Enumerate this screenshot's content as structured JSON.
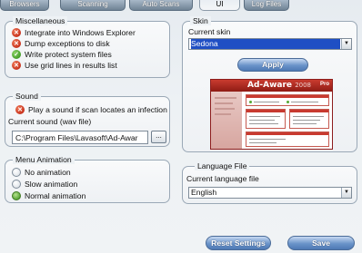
{
  "tabs": [
    {
      "label": "Browsers"
    },
    {
      "label": "Scanning"
    },
    {
      "label": "Auto Scans"
    },
    {
      "label": "UI"
    },
    {
      "label": "Log Files"
    }
  ],
  "miscellaneous": {
    "title": "Miscellaneous",
    "items": [
      {
        "label": "Integrate into Windows Explorer",
        "state": "off"
      },
      {
        "label": "Dump exceptions to disk",
        "state": "off"
      },
      {
        "label": "Write protect system files",
        "state": "on"
      },
      {
        "label": "Use grid lines in results list",
        "state": "off"
      }
    ]
  },
  "sound": {
    "title": "Sound",
    "play_label": "Play a sound if scan locates an infection",
    "current_label": "Current sound (wav file)",
    "file_value": "C:\\Program Files\\Lavasoft\\Ad-Awar",
    "browse_label": "..."
  },
  "menu_animation": {
    "title": "Menu Animation",
    "options": [
      {
        "label": "No animation"
      },
      {
        "label": "Slow animation"
      },
      {
        "label": "Normal animation"
      }
    ],
    "selected": "Normal animation"
  },
  "skin": {
    "title": "Skin",
    "current_label": "Current skin",
    "selected": "Sedona",
    "apply_label": "Apply",
    "preview": {
      "logo": "Ad-Aware",
      "year": "2008",
      "edition": "Pro"
    }
  },
  "language": {
    "title": "Language File",
    "current_label": "Current language file",
    "selected": "English"
  },
  "footer": {
    "reset_label": "Reset Settings",
    "save_label": "Save"
  },
  "colors": {
    "accent": "#4e79b4",
    "selection": "#1f4fc4",
    "off_icon": "#c8321c",
    "on_icon": "#3d9a22",
    "preview_brand": "#8f1b14"
  },
  "icons": {
    "off": "x-icon",
    "on": "check-icon"
  }
}
